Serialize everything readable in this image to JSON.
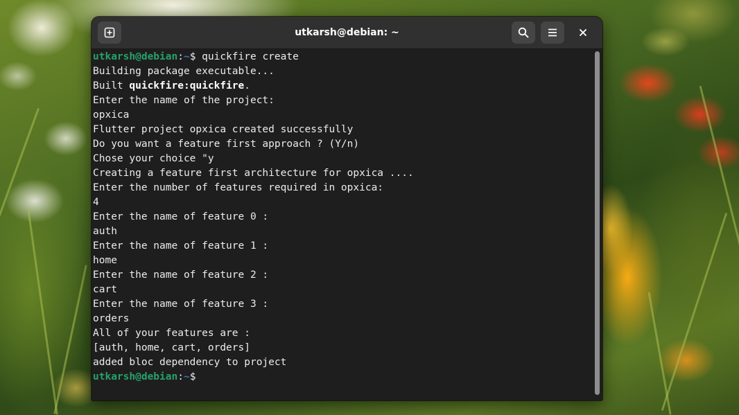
{
  "window": {
    "title": "utkarsh@debian: ~"
  },
  "prompt": {
    "user_host": "utkarsh@debian",
    "separator": ":",
    "dir": "~",
    "symbol": "$ "
  },
  "terminal": {
    "command": "quickfire create",
    "lines": [
      "Building package executable...",
      "Enter the name of the project:",
      "opxica",
      "Flutter project opxica created successfully",
      "Do you want a feature first approach ? (Y/n)",
      "Chose your choice \"y",
      "Creating a feature first architecture for opxica ....",
      "Enter the number of features required in opxica:",
      "4",
      "Enter the name of feature 0 :",
      "auth",
      "Enter the name of feature 1 :",
      "home",
      "Enter the name of feature 2 :",
      "cart",
      "Enter the name of feature 3 :",
      "orders",
      "All of your features are :",
      "[auth, home, cart, orders]",
      "added bloc dependency to project"
    ],
    "built_prefix": "Built ",
    "built_target": "quickfire:quickfire",
    "built_suffix": "."
  },
  "colors": {
    "prompt_user": "#26a269",
    "prompt_dir": "#3a6fd8",
    "terminal_bg": "#1e1e1e",
    "headerbar_bg": "#303030"
  },
  "icons": {
    "new_tab": "new-tab-icon",
    "search": "search-icon",
    "menu": "hamburger-menu-icon",
    "close": "close-icon"
  }
}
